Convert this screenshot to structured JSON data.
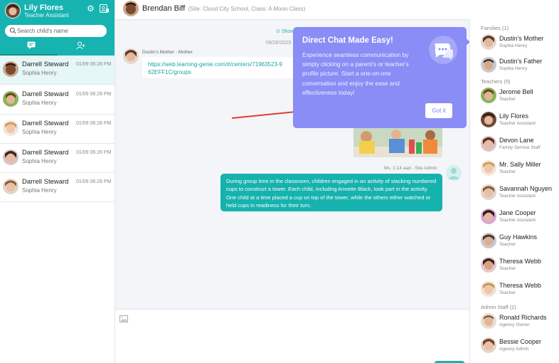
{
  "user": {
    "name": "Lily Flores",
    "role": "Teacher Assistant"
  },
  "search": {
    "placeholder": "Search child's name"
  },
  "conversations": [
    {
      "name": "Darrell Steward",
      "sub": "Sophia Henry",
      "time": "01/09 06:28 PM"
    },
    {
      "name": "Darrell Steward",
      "sub": "Sophia Henry",
      "time": "01/09 06:28 PM"
    },
    {
      "name": "Darrell Steward",
      "sub": "Sophia Henry",
      "time": "01/09 06:28 PM"
    },
    {
      "name": "Darrell Steward",
      "sub": "Sophia Henry",
      "time": "01/09 06:28 PM"
    },
    {
      "name": "Darrell Steward",
      "sub": "Sophia Henry",
      "time": "01/09 06:28 PM"
    }
  ],
  "chat": {
    "title": "Brendan Biff",
    "subtitle": "(Site: Cloud City School, Class: A Moon Class)",
    "show_more": "Show",
    "date": "09/26/2023",
    "messages": [
      {
        "sender": "Dustin's Mother - Mother",
        "text": "https://web.learning-genie.com/#/centers/71963523-9 62EFF1C/groups"
      },
      {
        "sender": "Ms. 2.14 aad - Site Admin",
        "text": "During group time in the classroom, children engaged in an activity of stacking numbered cups to construct a tower. Each child, including Annette Black, took part in the activity. One child at a time placed a cup on top of the tower, while the others either watched or held cups in readiness for their turn."
      }
    ]
  },
  "tooltip": {
    "title": "Direct Chat Made Easy!",
    "body": "Experience seamless communication by simply clicking on a parent's or teacher's profile picture. Start a one-on-one conversation and enjoy the ease and effectiveness today!",
    "button": "Got it"
  },
  "participants": {
    "families_label": "Families (1)",
    "families": [
      {
        "name": "Dustin's Mother",
        "role": "Sophia Henry"
      },
      {
        "name": "Dustin's Father",
        "role": "Sophia Henry"
      }
    ],
    "teachers_label": "Teachers (9)",
    "teachers": [
      {
        "name": "Jerome Bell",
        "role": "Teacher"
      },
      {
        "name": "Lily Flores",
        "role": "Teacher Assistant"
      },
      {
        "name": "Devon Lane",
        "role": "Family Service Staff"
      },
      {
        "name": "Mr. Sally Miller",
        "role": "Teacher"
      },
      {
        "name": "Savannah Nguyen",
        "role": "Teacher Assistant"
      },
      {
        "name": "Jane Cooper",
        "role": "Teacher Assistant"
      },
      {
        "name": "Guy Hawkins",
        "role": "Teacher"
      },
      {
        "name": "Theresa Webb",
        "role": "Teacher"
      },
      {
        "name": "Theresa Webb",
        "role": "Teacher"
      }
    ],
    "admin_label": "Admin Staff (2)",
    "admins": [
      {
        "name": "Ronald Richards",
        "role": "Agency Owner"
      },
      {
        "name": "Bessie Cooper",
        "role": "Agency Admin"
      }
    ]
  },
  "colors": {
    "accent": "#17b3b0",
    "tooltip": "#8a8df5",
    "arrow": "#e53935"
  }
}
